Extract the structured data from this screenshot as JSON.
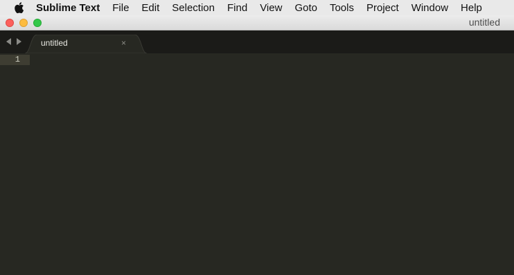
{
  "menubar": {
    "apple_icon": "apple-logo-icon",
    "items": [
      "Sublime Text",
      "File",
      "Edit",
      "Selection",
      "Find",
      "View",
      "Goto",
      "Tools",
      "Project",
      "Window",
      "Help"
    ]
  },
  "window": {
    "title": "untitled",
    "traffic_lights": {
      "close": "#fc605c",
      "minimize": "#fdbc40",
      "zoom": "#34c84a"
    }
  },
  "tabs": [
    {
      "label": "untitled",
      "close_glyph": "×",
      "active": true
    }
  ],
  "navigation": {
    "back_icon": "left-arrow-icon",
    "forward_icon": "right-arrow-icon"
  },
  "editor": {
    "line_numbers": [
      "1"
    ],
    "background": "#272822",
    "gutter_highlight": "#3e3d32"
  }
}
